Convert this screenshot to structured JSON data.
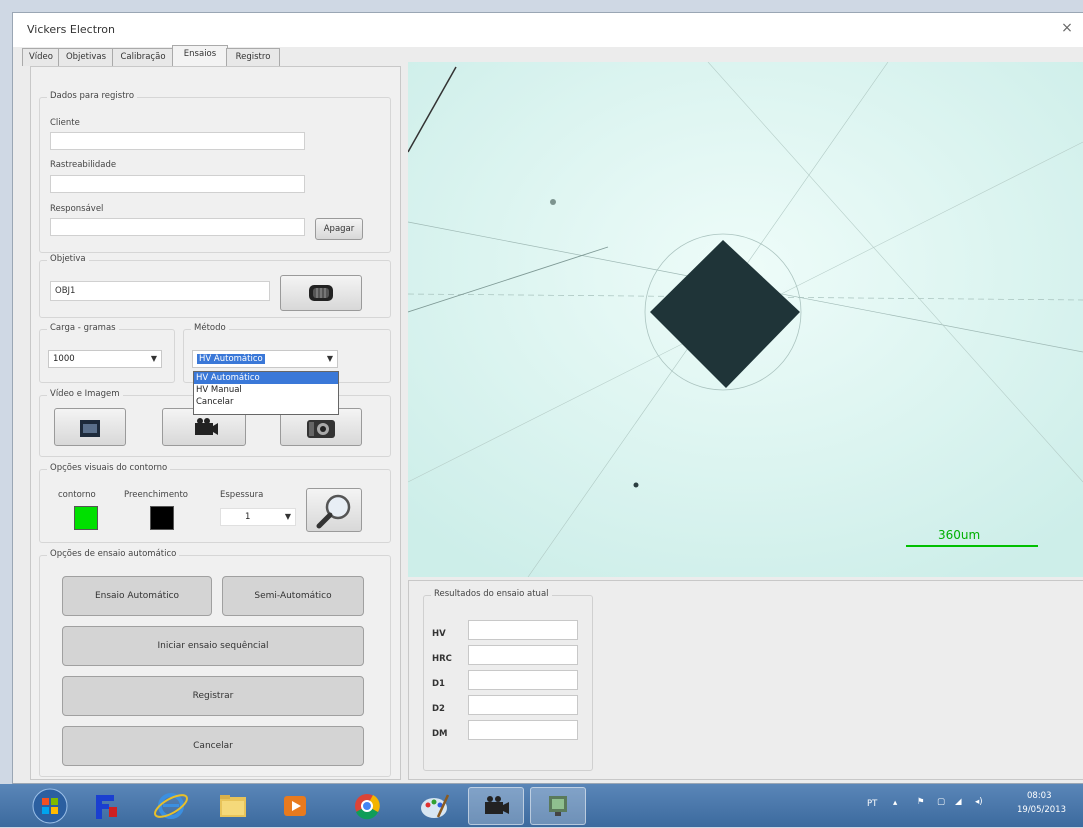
{
  "window": {
    "title": "Vickers Electron",
    "close_glyph": "×"
  },
  "tabs": [
    {
      "label": "Vídeo"
    },
    {
      "label": "Objetivas"
    },
    {
      "label": "Calibração"
    },
    {
      "label": "Ensaios"
    },
    {
      "label": "Registro"
    }
  ],
  "dados_registro": {
    "legend": "Dados para registro",
    "cliente_label": "Cliente",
    "cliente_value": "",
    "rastreabilidade_label": "Rastreabilidade",
    "rastreabilidade_value": "",
    "responsavel_label": "Responsável",
    "responsavel_value": "",
    "apagar_label": "Apagar"
  },
  "objetiva": {
    "legend": "Objetiva",
    "value": "OBJ1"
  },
  "carga": {
    "legend": "Carga - gramas",
    "value": "1000"
  },
  "metodo": {
    "legend": "Método",
    "selected": "HV Automático",
    "options": [
      "HV Automático",
      "HV Manual",
      "Cancelar"
    ]
  },
  "video_imagem": {
    "legend": "Vídeo e Imagem"
  },
  "contorno": {
    "legend": "Opções visuais do contorno",
    "contorno_label": "contorno",
    "preenchimento_label": "Preenchimento",
    "espessura_label": "Espessura",
    "espessura_value": "1",
    "contorno_color": "#00e000",
    "preenchimento_color": "#000000"
  },
  "automatico": {
    "legend": "Opções de ensaio automático",
    "ensaio_auto": "Ensaio Automático",
    "semi_auto": "Semi-Automático",
    "iniciar_seq": "Iniciar ensaio sequêncial",
    "registrar": "Registrar",
    "cancelar": "Cancelar"
  },
  "image": {
    "scale_label": "360um"
  },
  "results": {
    "legend": "Resultados do ensaio atual",
    "rows": [
      {
        "label": "HV",
        "value": ""
      },
      {
        "label": "HRC",
        "value": ""
      },
      {
        "label": "D1",
        "value": ""
      },
      {
        "label": "D2",
        "value": ""
      },
      {
        "label": "DM",
        "value": ""
      }
    ]
  },
  "taskbar": {
    "lang": "PT",
    "time": "08:03",
    "date": "19/05/2013"
  }
}
